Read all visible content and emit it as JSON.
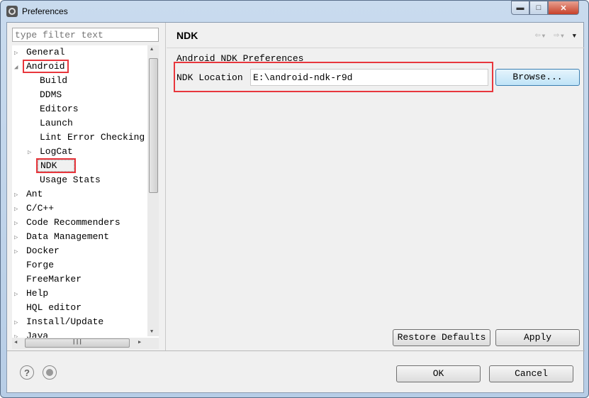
{
  "window": {
    "title": "Preferences",
    "controls": [
      "minimize",
      "maximize",
      "close"
    ]
  },
  "sidebar": {
    "filter_placeholder": "type filter text",
    "items": [
      {
        "label": "General",
        "level": 0,
        "expander": "collapsed"
      },
      {
        "label": "Android",
        "level": 0,
        "expander": "expanded",
        "highlighted": true
      },
      {
        "label": "Build",
        "level": 1,
        "expander": "none"
      },
      {
        "label": "DDMS",
        "level": 1,
        "expander": "none"
      },
      {
        "label": "Editors",
        "level": 1,
        "expander": "none"
      },
      {
        "label": "Launch",
        "level": 1,
        "expander": "none"
      },
      {
        "label": "Lint Error Checking",
        "level": 1,
        "expander": "none"
      },
      {
        "label": "LogCat",
        "level": 1,
        "expander": "collapsed"
      },
      {
        "label": "NDK",
        "level": 1,
        "expander": "none",
        "selected": true,
        "highlighted": true
      },
      {
        "label": "Usage Stats",
        "level": 1,
        "expander": "none"
      },
      {
        "label": "Ant",
        "level": 0,
        "expander": "collapsed"
      },
      {
        "label": "C/C++",
        "level": 0,
        "expander": "collapsed"
      },
      {
        "label": "Code Recommenders",
        "level": 0,
        "expander": "collapsed"
      },
      {
        "label": "Data Management",
        "level": 0,
        "expander": "collapsed"
      },
      {
        "label": "Docker",
        "level": 0,
        "expander": "collapsed"
      },
      {
        "label": "Forge",
        "level": 0,
        "expander": "none"
      },
      {
        "label": "FreeMarker",
        "level": 0,
        "expander": "none"
      },
      {
        "label": "Help",
        "level": 0,
        "expander": "collapsed"
      },
      {
        "label": "HQL editor",
        "level": 0,
        "expander": "none"
      },
      {
        "label": "Install/Update",
        "level": 0,
        "expander": "collapsed"
      },
      {
        "label": "Java",
        "level": 0,
        "expander": "collapsed"
      }
    ]
  },
  "main": {
    "title": "NDK",
    "section_label": "Android NDK Preferences",
    "ndk_location_label": "NDK Location",
    "ndk_location_value": "E:\\android-ndk-r9d",
    "browse_label": "Browse...",
    "restore_defaults_label": "Restore Defaults",
    "apply_label": "Apply"
  },
  "footer": {
    "ok_label": "OK",
    "cancel_label": "Cancel",
    "help_icon": "?"
  },
  "colors": {
    "highlight": "#e8373d",
    "browse_button": "#bfe3f7"
  }
}
